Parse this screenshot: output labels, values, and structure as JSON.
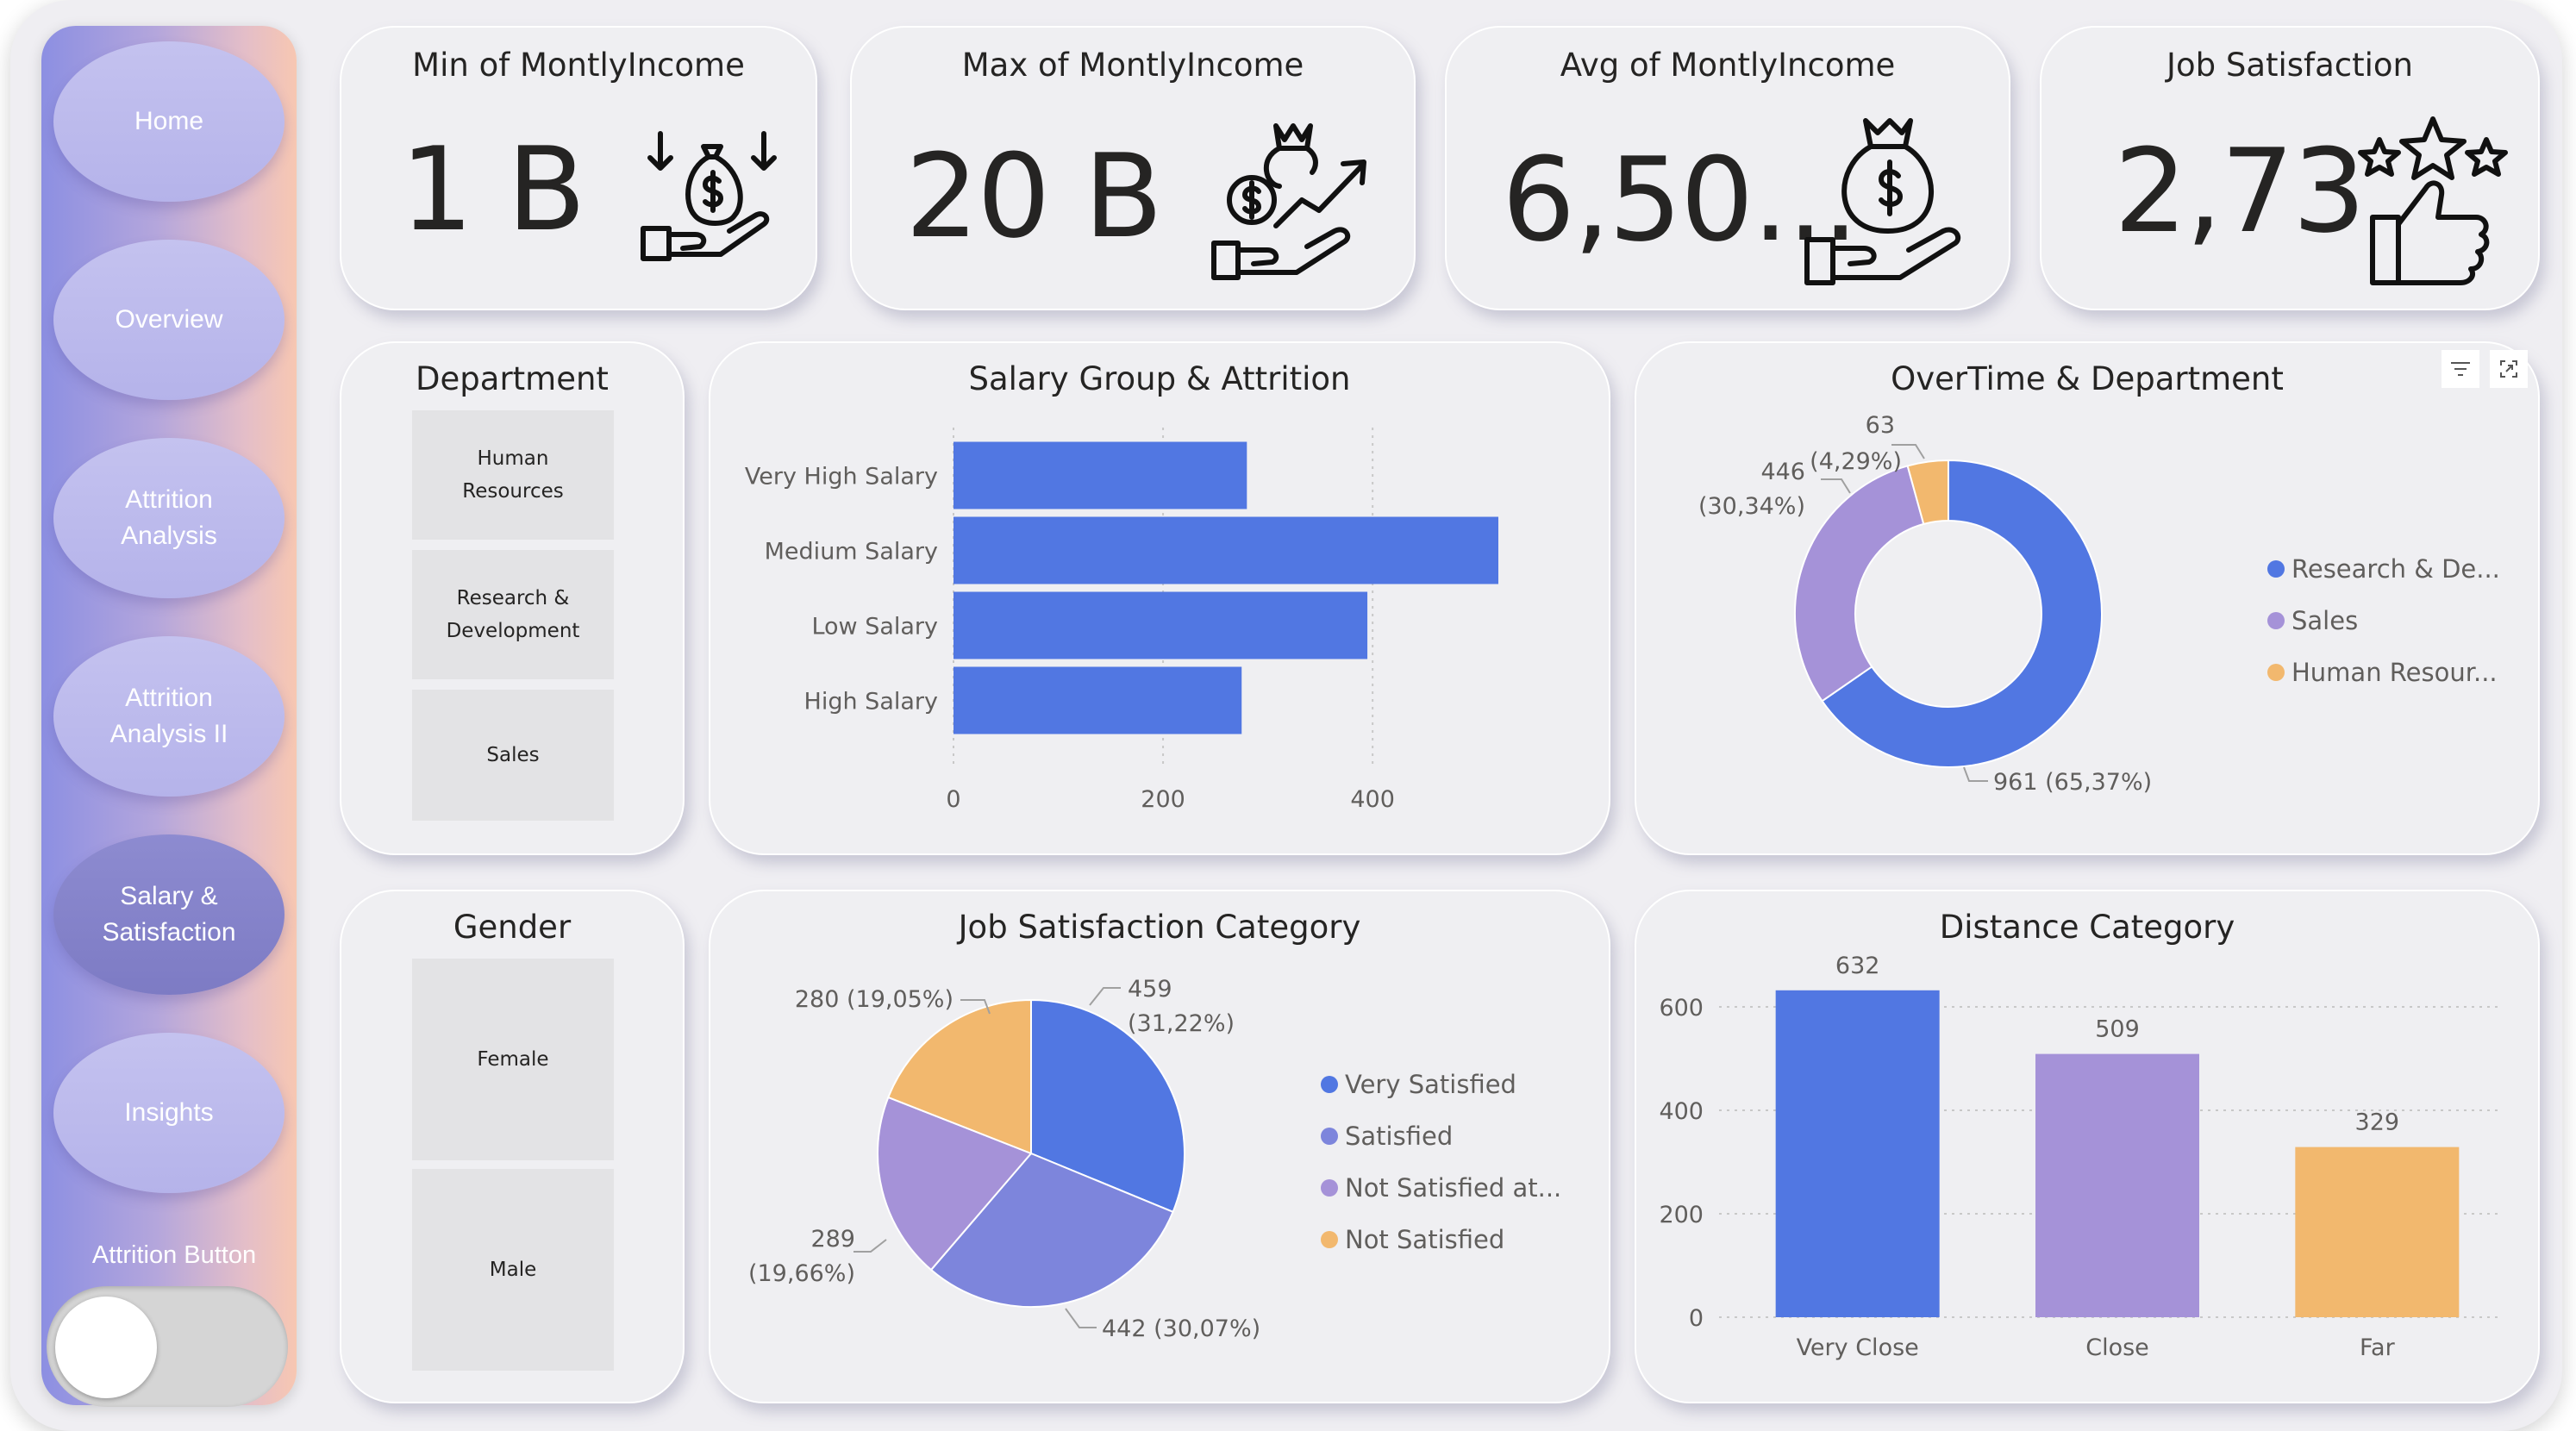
{
  "nav": {
    "items": [
      {
        "label": "Home",
        "active": false
      },
      {
        "label": "Overview",
        "active": false
      },
      {
        "label": "Attrition\nAnalysis",
        "active": false
      },
      {
        "label": "Attrition\nAnalysis II",
        "active": false
      },
      {
        "label": "Salary &\nSatisfaction",
        "active": true
      },
      {
        "label": "Insights",
        "active": false
      }
    ],
    "toggle_label": "Attrition Button"
  },
  "kpis": [
    {
      "title": "Min of MontlyIncome",
      "value": "1 B",
      "icon": "money-bag-down-icon"
    },
    {
      "title": "Max of MontlyIncome",
      "value": "20 B",
      "icon": "money-growth-icon"
    },
    {
      "title": "Avg of MontlyIncome",
      "value": "6,50...",
      "icon": "money-bag-hand-icon"
    },
    {
      "title": "Job Satisfaction",
      "value": "2,73",
      "icon": "stars-thumbs-up-icon"
    }
  ],
  "department_slicer": {
    "title": "Department",
    "items": [
      "Human\nResources",
      "Research &\nDevelopment",
      "Sales"
    ]
  },
  "gender_slicer": {
    "title": "Gender",
    "items": [
      "Female",
      "Male"
    ]
  },
  "colors": {
    "blue": "#5177e2",
    "lavender": "#a592d8",
    "slate": "#7d85dc",
    "orange": "#f2b86e"
  },
  "chart_data": [
    {
      "id": "salary",
      "type": "bar",
      "orientation": "horizontal",
      "title": "Salary Group & Attrition",
      "categories": [
        "Very High Salary",
        "Medium Salary",
        "Low Salary",
        "High Salary"
      ],
      "values": [
        280,
        520,
        395,
        275
      ],
      "xlim": [
        0,
        520
      ],
      "xticks": [
        0,
        200,
        400
      ],
      "grid": true
    },
    {
      "id": "overtime",
      "type": "pie",
      "donut": true,
      "title": "OverTime & Department",
      "slices": [
        {
          "name": "Research & De...",
          "value": 961,
          "label": "961 (65,37%)",
          "color": "#5177e2"
        },
        {
          "name": "Sales",
          "value": 446,
          "label_value": "446",
          "label_pct": "(30,34%)",
          "color": "#a592d8"
        },
        {
          "name": "Human Resour...",
          "value": 63,
          "label_value": "63",
          "label_pct": "(4,29%)",
          "color": "#f2b86e"
        }
      ],
      "legend_position": "right"
    },
    {
      "id": "jobsat",
      "type": "pie",
      "title": "Job Satisfaction Category",
      "slices": [
        {
          "name": "Very Satisfied",
          "value": 459,
          "label_value": "459",
          "label_pct": "(31,22%)",
          "color": "#5177e2"
        },
        {
          "name": "Satisfied",
          "value": 442,
          "label": "442 (30,07%)",
          "color": "#7d85dc"
        },
        {
          "name": "Not Satisfied at...",
          "value": 289,
          "label_value": "289",
          "label_pct": "(19,66%)",
          "color": "#a592d8"
        },
        {
          "name": "Not Satisfied",
          "value": 280,
          "label": "280 (19,05%)",
          "color": "#f2b86e"
        }
      ],
      "legend_position": "right"
    },
    {
      "id": "distance",
      "type": "bar",
      "orientation": "vertical",
      "title": "Distance Category",
      "categories": [
        "Very Close",
        "Close",
        "Far"
      ],
      "values": [
        632,
        509,
        329
      ],
      "colors": [
        "#5177e2",
        "#a592d8",
        "#f2b86e"
      ],
      "ylim": [
        0,
        650
      ],
      "yticks": [
        0,
        200,
        400,
        600
      ],
      "grid": true
    }
  ]
}
